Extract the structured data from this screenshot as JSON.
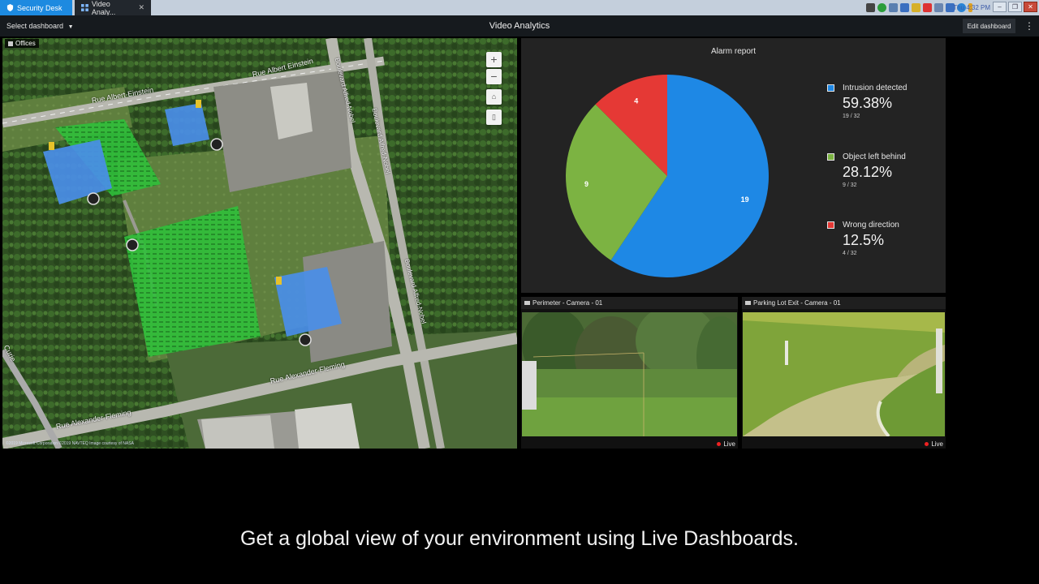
{
  "tabs": [
    {
      "label": "Security Desk",
      "icon": "security-desk-icon"
    },
    {
      "label": "Video Analy...",
      "icon": "dashboard-icon"
    }
  ],
  "clock": "Thu 4:32 PM",
  "toolbar": {
    "select_dashboard": "Select dashboard",
    "title": "Video Analytics",
    "edit_dashboard": "Edit dashboard",
    "more_label": "⋮"
  },
  "map": {
    "title": "Offices",
    "zoom_in": "+",
    "zoom_out": "−",
    "home": "⌂",
    "layers": "▯",
    "copyright": "©2019 Microsoft Corporation ©2019 NAVTEQ Image courtesy of NASA",
    "roads": {
      "albert_einstein_1": "Rue Albert-Einstein",
      "albert_einstein_2": "Rue Albert Einstein",
      "alfred_nobel_1": "Boulevard Alfred-Nobel",
      "alfred_nobel_2": "Boulevard Alfred-Nobel",
      "alfred_nobel_3": "Boulevard Alfred-Nobel",
      "alexander_fleming_1": "Rue Alexander-Fleming",
      "alexander_fleming_2": "Rue Alexander-Fleming",
      "curie": "Curie"
    }
  },
  "chart_data": {
    "type": "pie",
    "title": "Alarm report",
    "total": 32,
    "slices": [
      {
        "name": "Intrusion detected",
        "value": 19,
        "percent": "59.38%",
        "fraction": "19 / 32",
        "color": "#1e88e5"
      },
      {
        "name": "Object left behind",
        "value": 9,
        "percent": "28.12%",
        "fraction": "9 / 32",
        "color": "#7cb342"
      },
      {
        "name": "Wrong direction",
        "value": 4,
        "percent": "12.5%",
        "fraction": "4 / 32",
        "color": "#e53935"
      }
    ],
    "legend_position": "right"
  },
  "cameras": [
    {
      "title": "Perimeter - Camera - 01",
      "status": "Live"
    },
    {
      "title": "Parking Lot Exit - Camera - 01",
      "status": "Live"
    }
  ],
  "caption": "Get a global view of your environment using Live Dashboards."
}
